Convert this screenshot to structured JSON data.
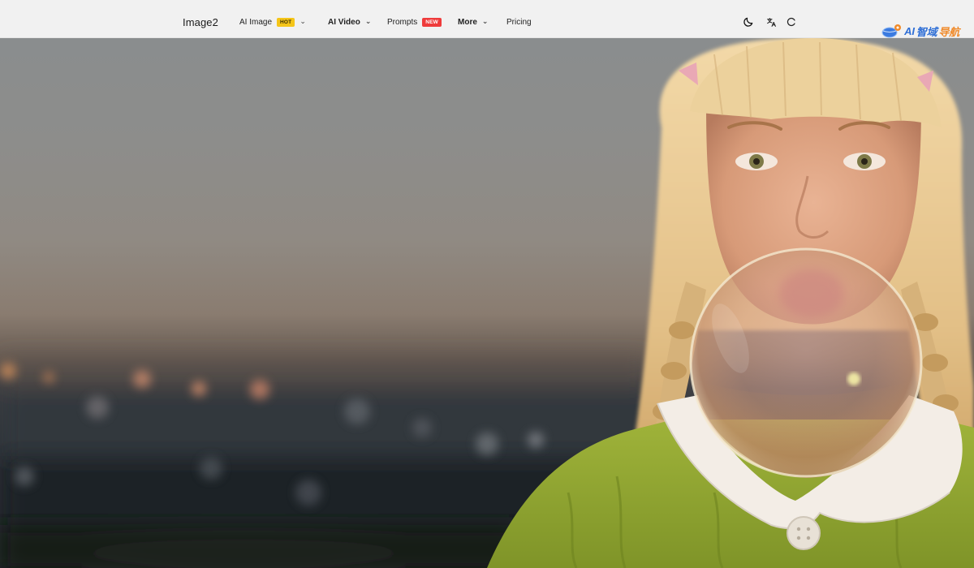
{
  "navbar": {
    "brand": "Image2",
    "items": [
      {
        "label": "AI Image",
        "badge": "HOT",
        "has_dropdown": true
      },
      {
        "label": "AI Video",
        "badge": "",
        "has_dropdown": true
      },
      {
        "label": "Prompts",
        "badge": "NEW",
        "has_dropdown": false
      },
      {
        "label": "More",
        "badge": "",
        "has_dropdown": true
      },
      {
        "label": "Pricing",
        "badge": "",
        "has_dropdown": false
      }
    ],
    "chevron": "⌄",
    "icons": [
      "moon-icon",
      "translate-icon",
      "loading-icon"
    ]
  },
  "watermark": {
    "ai": "AI",
    "zh": "智域",
    "nav": "导航"
  },
  "colors": {
    "hot_badge": "#f5c518",
    "new_badge": "#ef3b3b",
    "watermark_blue": "#2f6fd6",
    "watermark_orange": "#f08a2a"
  }
}
